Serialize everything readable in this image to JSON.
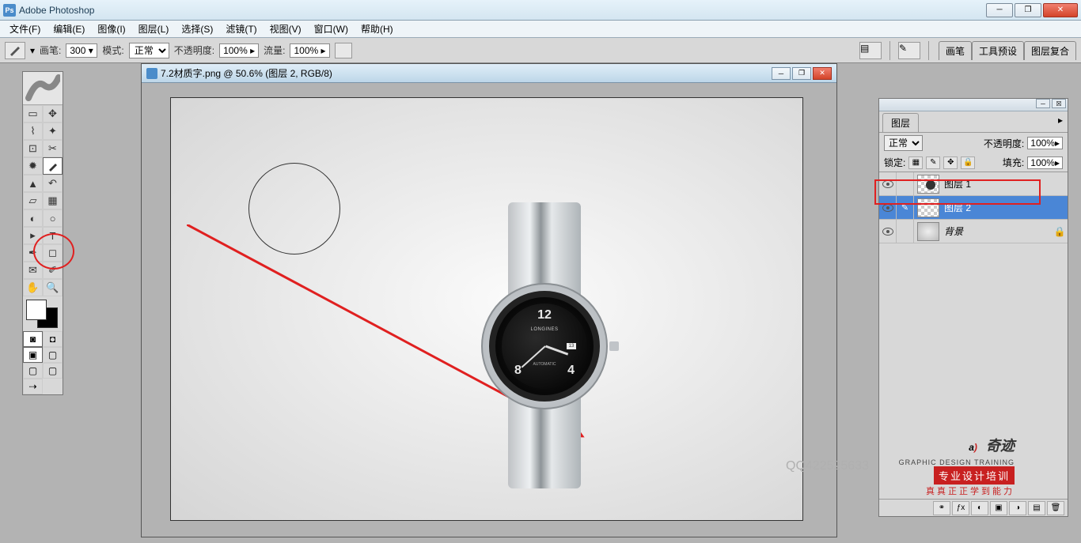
{
  "app": {
    "title": "Adobe Photoshop"
  },
  "menu": {
    "file": "文件(F)",
    "edit": "编辑(E)",
    "image": "图像(I)",
    "layer": "图层(L)",
    "select": "选择(S)",
    "filter": "滤镜(T)",
    "view": "视图(V)",
    "window": "窗口(W)",
    "help": "帮助(H)"
  },
  "options": {
    "brush_label": "画笔:",
    "brush_size": "300",
    "mode_label": "模式:",
    "mode_value": "正常",
    "opacity_label": "不透明度:",
    "opacity_value": "100%",
    "flow_label": "流量:",
    "flow_value": "100%",
    "tabs": {
      "brushes": "画笔",
      "tool_presets": "工具预设",
      "layer_comps": "图层复合"
    }
  },
  "document": {
    "title": "7.2材质字.png @ 50.6% (图层 2, RGB/8)"
  },
  "watch": {
    "brand": "LONGINES",
    "auto": "AUTOMATIC",
    "date": "13",
    "n12": "12",
    "n8": "8",
    "n4": "4"
  },
  "layers_panel": {
    "tab": "图层",
    "blend_mode": "正常",
    "opacity_label": "不透明度:",
    "opacity_value": "100%",
    "lock_label": "锁定:",
    "fill_label": "填充:",
    "fill_value": "100%",
    "layers": [
      {
        "name": "图层 1"
      },
      {
        "name": "图层 2"
      },
      {
        "name": "背景"
      }
    ]
  },
  "watermark": {
    "qq": "QQ422525633",
    "brand_cn": "奇迹",
    "en": "GRAPHIC DESIGN TRAINING",
    "bar": "专业设计培训",
    "sub": "真真正正学到能力"
  }
}
